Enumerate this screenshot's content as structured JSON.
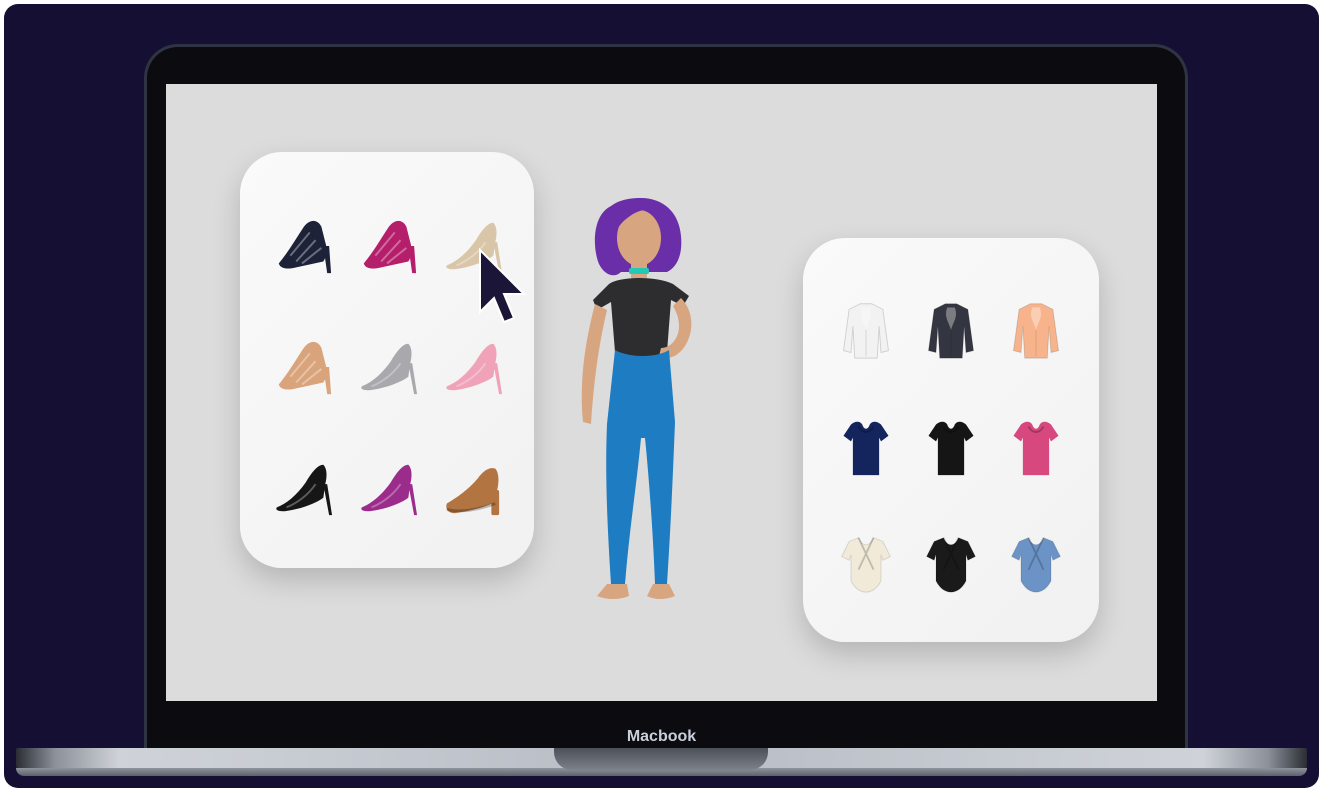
{
  "device": {
    "label": "Macbook"
  },
  "shoe_panel": {
    "items": [
      {
        "icon": "strappy-sandal-heel-icon",
        "color": "#1d2238"
      },
      {
        "icon": "strappy-sandal-heel-icon",
        "color": "#b51e6a"
      },
      {
        "icon": "pump-heel-icon",
        "color": "#d9c6a9"
      },
      {
        "icon": "strappy-sandal-heel-icon",
        "color": "#d9a47c"
      },
      {
        "icon": "pump-heel-icon",
        "color": "#a8a8ad"
      },
      {
        "icon": "pump-heel-icon",
        "color": "#f0a3b8"
      },
      {
        "icon": "pump-heel-icon",
        "color": "#161616"
      },
      {
        "icon": "pump-heel-icon",
        "color": "#9b2c8c"
      },
      {
        "icon": "platform-pump-icon",
        "color": "#b27441"
      }
    ]
  },
  "top_panel": {
    "items": [
      {
        "icon": "ruffle-blouse-icon",
        "color": "#f2f2f2"
      },
      {
        "icon": "ruffle-blouse-icon",
        "color": "#333640"
      },
      {
        "icon": "ruffle-blouse-icon",
        "color": "#f7b48c"
      },
      {
        "icon": "cap-sleeve-top-icon",
        "color": "#14255e"
      },
      {
        "icon": "cap-sleeve-top-icon",
        "color": "#151515"
      },
      {
        "icon": "cap-sleeve-top-icon",
        "color": "#d6487e"
      },
      {
        "icon": "wrap-bodysuit-icon",
        "color": "#f1ead8"
      },
      {
        "icon": "wrap-bodysuit-icon",
        "color": "#1a1a1a"
      },
      {
        "icon": "wrap-bodysuit-icon",
        "color": "#6b93c5"
      }
    ]
  },
  "avatar": {
    "icon": "avatar-figure-icon",
    "hair_color": "#6a2fa8",
    "top_color": "#2d2d2f",
    "pants_color": "#1e7cc2",
    "choker_color": "#23c9b4",
    "skin_color": "#d7a57f"
  },
  "cursor": {
    "icon": "mouse-pointer-icon",
    "color": "#1b1638"
  },
  "colors": {
    "background": "#150f33",
    "screen": "#dcdcdc",
    "panel": "#f6f6f6"
  }
}
